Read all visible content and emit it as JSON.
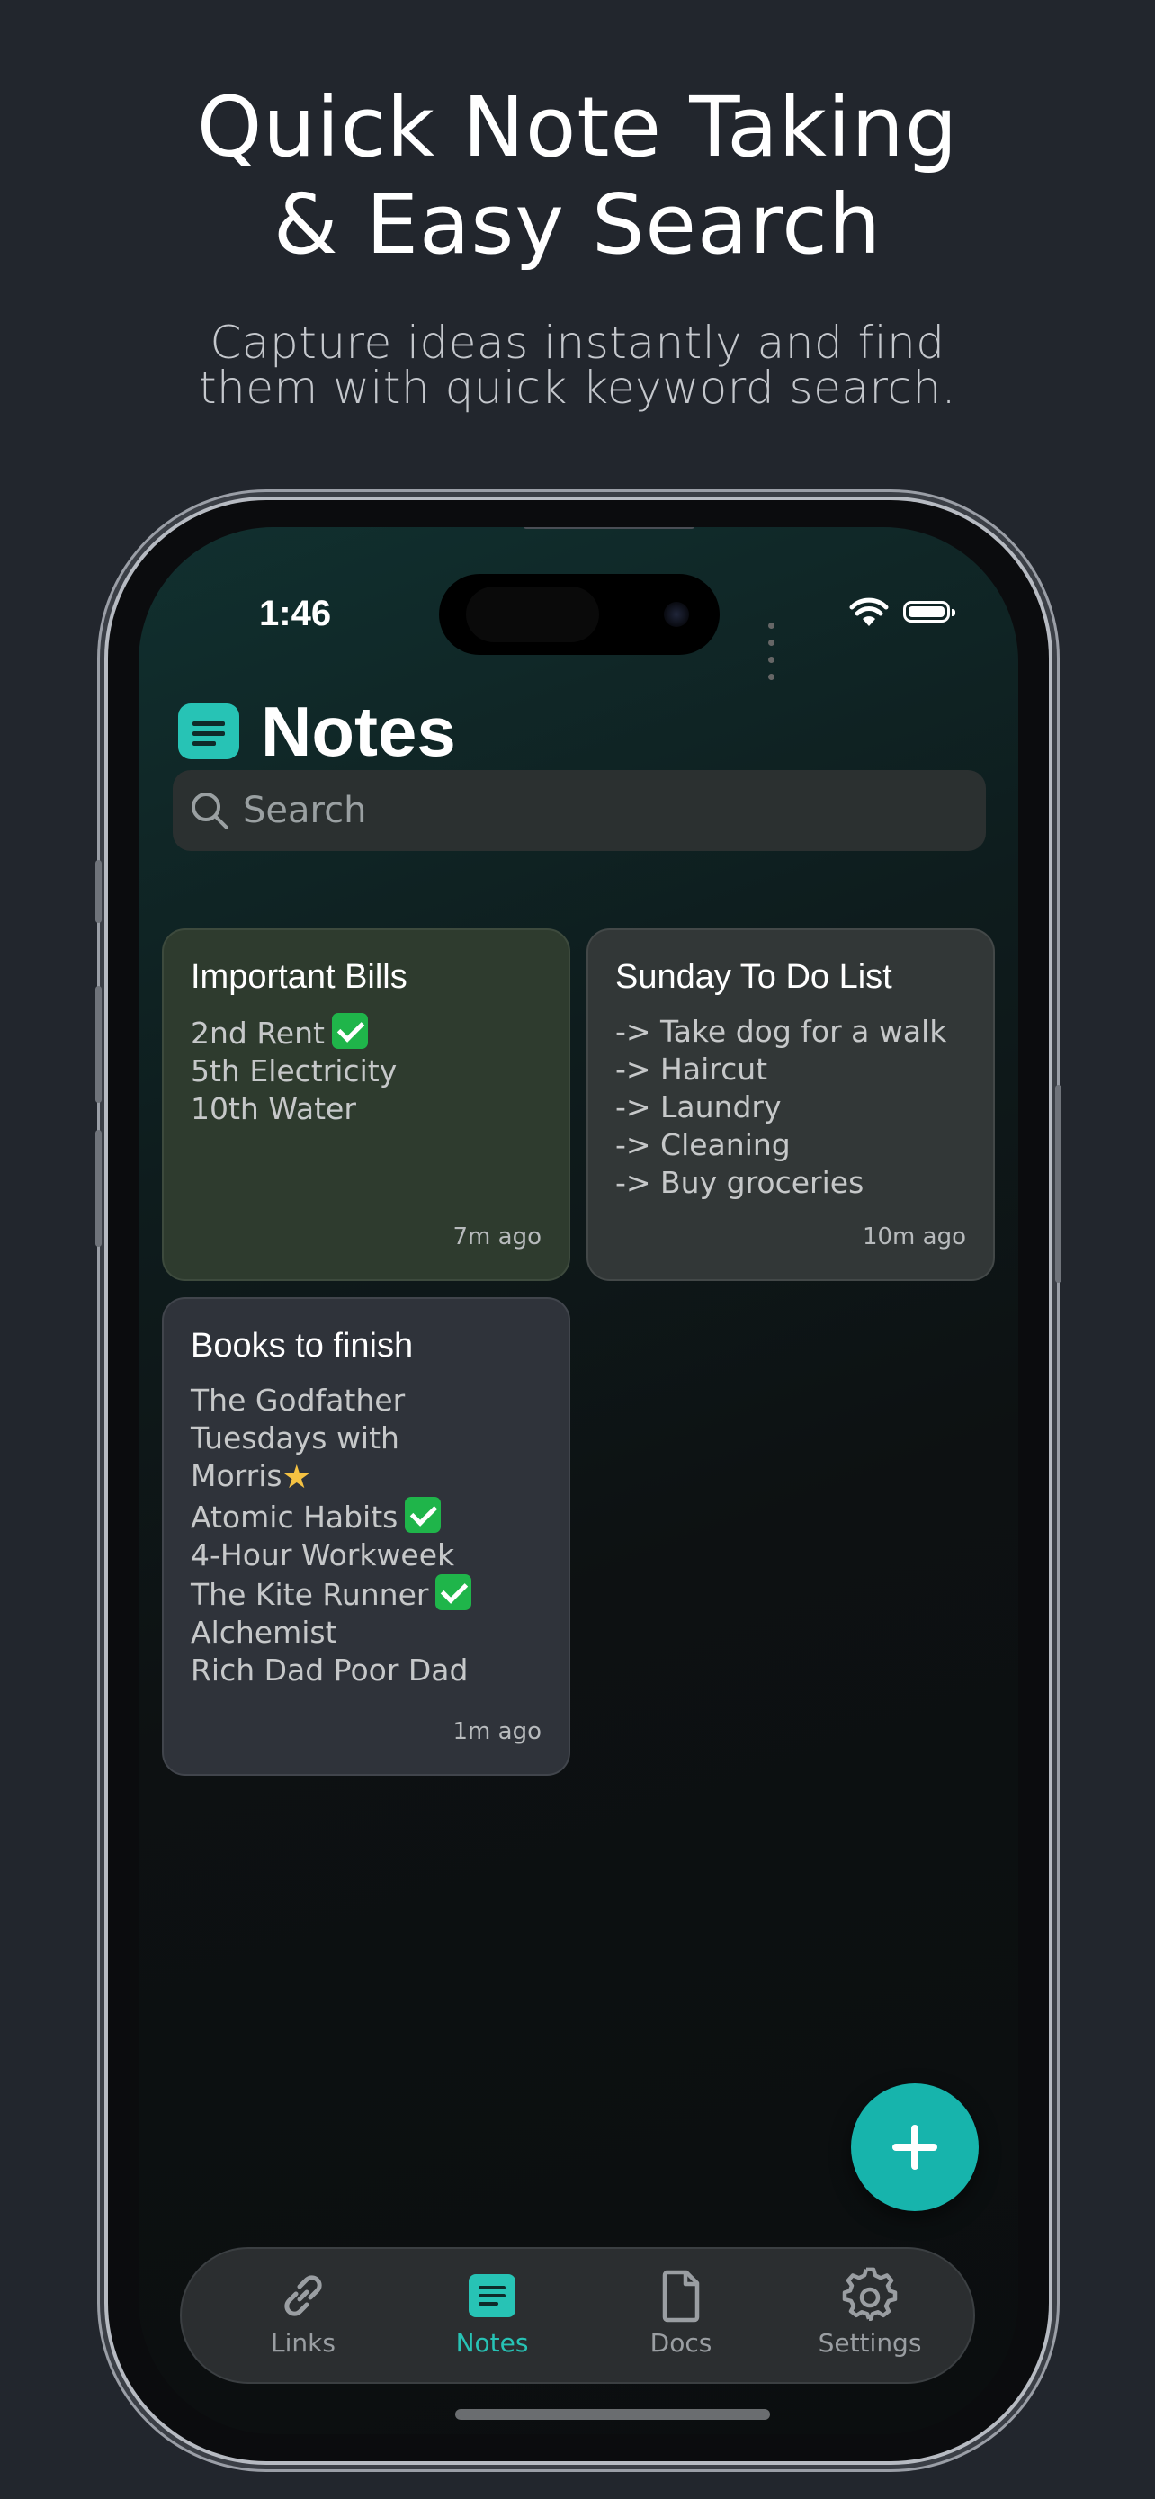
{
  "hero": {
    "title_line1": "Quick Note Taking",
    "title_line2": "& Easy Search",
    "subtitle_line1": "Capture ideas instantly and find",
    "subtitle_line2": "them with quick keyword search."
  },
  "status_bar": {
    "time": "1:46"
  },
  "app": {
    "title": "Notes",
    "icon": "notes-icon"
  },
  "search": {
    "placeholder": "Search"
  },
  "notes": [
    {
      "title": "Important Bills",
      "lines": [
        "2nd Rent",
        "5th Electricity",
        "10th Water"
      ],
      "time": "7m ago",
      "color": "#2e3b2e"
    },
    {
      "title": "Sunday To Do List",
      "lines": [
        "-> Take dog for a walk",
        "-> Haircut",
        "-> Laundry",
        "-> Cleaning",
        "-> Buy groceries"
      ],
      "time": "10m ago",
      "color": "#323737"
    },
    {
      "title": "Books to finish",
      "lines": [
        "The Godfather",
        "Tuesdays with",
        "Morris",
        "Atomic Habits",
        "4-Hour Workweek",
        "The Kite Runner",
        "Alchemist",
        "Rich Dad Poor Dad"
      ],
      "time": "1m ago",
      "color": "#2f333a"
    }
  ],
  "tabs": [
    {
      "label": "Links",
      "icon": "link-icon"
    },
    {
      "label": "Notes",
      "icon": "notes-icon",
      "active": true
    },
    {
      "label": "Docs",
      "icon": "document-icon"
    },
    {
      "label": "Settings",
      "icon": "gear-icon"
    }
  ],
  "colors": {
    "accent": "#27c3b5",
    "fab": "#17b4ac",
    "background": "#22262d"
  }
}
